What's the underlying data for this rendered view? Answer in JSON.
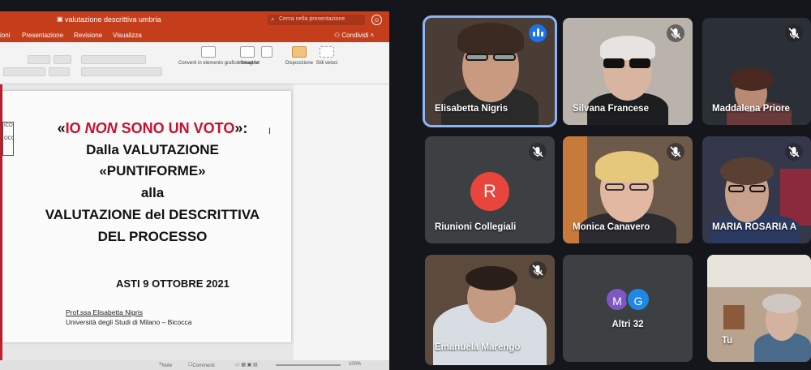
{
  "ppt": {
    "window_title": "valutazione descrittiva umbria",
    "search_placeholder": "Cerca nella presentazione",
    "account_icon": "smiley-icon",
    "menu": [
      "ioni",
      "Presentazione",
      "Revisione",
      "Visualizza"
    ],
    "share_label": "Condividi",
    "ribbon": {
      "smartart_label": "Converti in elemento grafico SmartArt",
      "image_label": "Immagine",
      "layout_label": "Disposizione",
      "styles_label": "Stili veloci"
    },
    "slide": {
      "line1_open": "«",
      "line1_io": "IO ",
      "line1_non": "NON",
      "line1_rest": " SONO UN VOTO",
      "line1_close": "»:",
      "line2": "Dalla VALUTAZIONE",
      "line3": "«PUNTIFORME»",
      "line4": "alla",
      "line5": "VALUTAZIONE del DESCRITTIVA",
      "line6": "DEL PROCESSO",
      "date": "ASTI 9 OTTOBRE 2021",
      "author": "Prof.ssa Elisabetta Nigris",
      "university": "Università degli Studi di Milano – Bicocca",
      "logo_text": "ICON\nOCCA"
    },
    "status": {
      "notes": "Note",
      "comments": "Commenti",
      "zoom": "100%"
    }
  },
  "participants": [
    {
      "name": "Elisabetta Nigris",
      "state": "speaking"
    },
    {
      "name": "Silvana Francese",
      "state": "muted"
    },
    {
      "name": "Maddalena Priore",
      "state": "muted"
    },
    {
      "name": "Riunioni Collegiali",
      "state": "muted",
      "avatar_letter": "R"
    },
    {
      "name": "Monica Canavero",
      "state": "muted"
    },
    {
      "name": "MARIA ROSARIA A",
      "state": "muted"
    },
    {
      "name": "Emanuela Marengo",
      "state": "muted"
    },
    {
      "name": "Altri 32",
      "avatars": [
        "M",
        "G"
      ]
    },
    {
      "name": "Tu",
      "state": "self"
    }
  ],
  "colors": {
    "ppt_red": "#c43e1c",
    "slide_red": "#c8102e",
    "active_border": "#8ab4f8",
    "tile_bg": "#3c4043",
    "avatar_r": "#e8453c",
    "avatar_m": "#7e57c2",
    "avatar_g": "#1e88e5"
  }
}
